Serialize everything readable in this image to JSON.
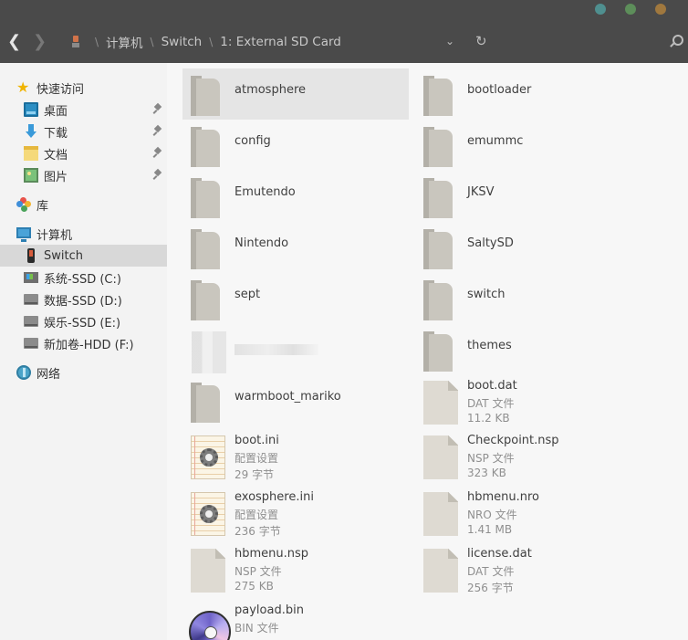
{
  "window": {
    "controls": [
      {
        "name": "control-dot-1",
        "color": "#4f8f8f"
      },
      {
        "name": "control-dot-2",
        "color": "#5d8e5a"
      },
      {
        "name": "control-dot-3",
        "color": "#a0783e"
      }
    ]
  },
  "address": {
    "back_glyph": "❮",
    "forward_glyph": "❯",
    "crumbs": [
      "计算机",
      "Switch",
      "1: External SD Card"
    ],
    "separator": "\\",
    "dropdown_glyph": "⌄",
    "refresh_glyph": "↻",
    "icons": [
      "back-icon",
      "forward-icon",
      "switch-device-icon",
      "chevron-down-icon",
      "refresh-icon",
      "search-icon"
    ]
  },
  "sidebar": {
    "quick_access": {
      "label": "快速访问",
      "icon": "star-icon"
    },
    "pinned": [
      {
        "label": "桌面",
        "icon": "desktop-icon"
      },
      {
        "label": "下载",
        "icon": "download-icon"
      },
      {
        "label": "文档",
        "icon": "documents-icon"
      },
      {
        "label": "图片",
        "icon": "pictures-icon"
      }
    ],
    "library": {
      "label": "库",
      "icon": "library-icon"
    },
    "computer": {
      "label": "计算机",
      "icon": "computer-icon"
    },
    "devices": [
      {
        "label": "Switch",
        "icon": "switch-device-icon",
        "selected": true
      },
      {
        "label": "系统-SSD (C:)",
        "icon": "windows-drive-icon"
      },
      {
        "label": "数据-SSD (D:)",
        "icon": "drive-icon"
      },
      {
        "label": "娱乐-SSD (E:)",
        "icon": "drive-icon"
      },
      {
        "label": "新加卷-HDD (F:)",
        "icon": "drive-icon"
      }
    ],
    "network": {
      "label": "网络",
      "icon": "network-icon"
    }
  },
  "items": [
    {
      "name": "atmosphere",
      "kind": "folder",
      "icon": "folder-icon",
      "highlighted": true
    },
    {
      "name": "bootloader",
      "kind": "folder",
      "icon": "folder-icon"
    },
    {
      "name": "config",
      "kind": "folder",
      "icon": "folder-icon"
    },
    {
      "name": "emummc",
      "kind": "folder",
      "icon": "folder-icon"
    },
    {
      "name": "Emutendo",
      "kind": "folder",
      "icon": "folder-icon"
    },
    {
      "name": "JKSV",
      "kind": "folder",
      "icon": "folder-icon"
    },
    {
      "name": "Nintendo",
      "kind": "folder",
      "icon": "folder-icon"
    },
    {
      "name": "SaltySD",
      "kind": "folder",
      "icon": "folder-icon"
    },
    {
      "name": "sept",
      "kind": "folder",
      "icon": "folder-icon"
    },
    {
      "name": "switch",
      "kind": "folder",
      "icon": "folder-icon"
    },
    {
      "name": "",
      "kind": "blurred",
      "icon": "blurred-item-icon"
    },
    {
      "name": "themes",
      "kind": "folder",
      "icon": "folder-icon"
    },
    {
      "name": "warmboot_mariko",
      "kind": "folder",
      "icon": "folder-icon"
    },
    {
      "name": "boot.dat",
      "kind": "file",
      "icon": "file-icon",
      "type": "DAT 文件",
      "size": "11.2 KB"
    },
    {
      "name": "boot.ini",
      "kind": "ini",
      "icon": "settings-file-icon",
      "type": "配置设置",
      "size": "29 字节"
    },
    {
      "name": "Checkpoint.nsp",
      "kind": "file",
      "icon": "file-icon",
      "type": "NSP 文件",
      "size": "323 KB"
    },
    {
      "name": "exosphere.ini",
      "kind": "ini",
      "icon": "settings-file-icon",
      "type": "配置设置",
      "size": "236 字节"
    },
    {
      "name": "hbmenu.nro",
      "kind": "file",
      "icon": "file-icon",
      "type": "NRO 文件",
      "size": "1.41 MB"
    },
    {
      "name": "hbmenu.nsp",
      "kind": "file",
      "icon": "file-icon",
      "type": "NSP 文件",
      "size": "275 KB"
    },
    {
      "name": "license.dat",
      "kind": "file",
      "icon": "file-icon",
      "type": "DAT 文件",
      "size": "256 字节"
    },
    {
      "name": "payload.bin",
      "kind": "disc",
      "icon": "disc-image-icon",
      "type": "BIN 文件",
      "size": ""
    }
  ]
}
